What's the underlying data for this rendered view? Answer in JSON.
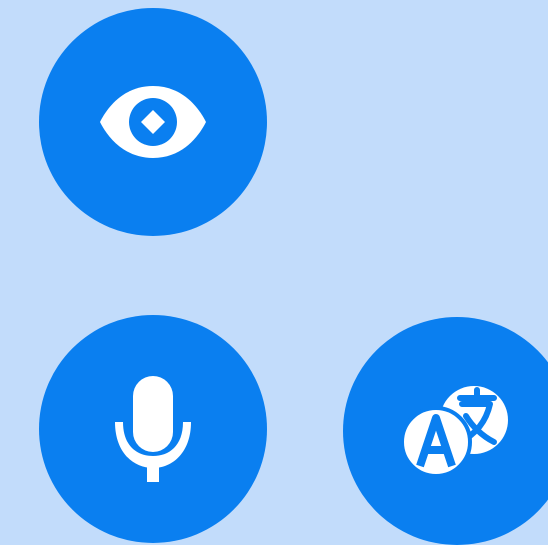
{
  "buttons": [
    {
      "id": "eye",
      "icon": "eye-icon"
    },
    {
      "id": "mic",
      "icon": "microphone-icon"
    },
    {
      "id": "translate",
      "icon": "translate-icon"
    }
  ],
  "colors": {
    "background": "#c2dcfb",
    "button": "#0a7ff0",
    "icon": "#ffffff"
  }
}
